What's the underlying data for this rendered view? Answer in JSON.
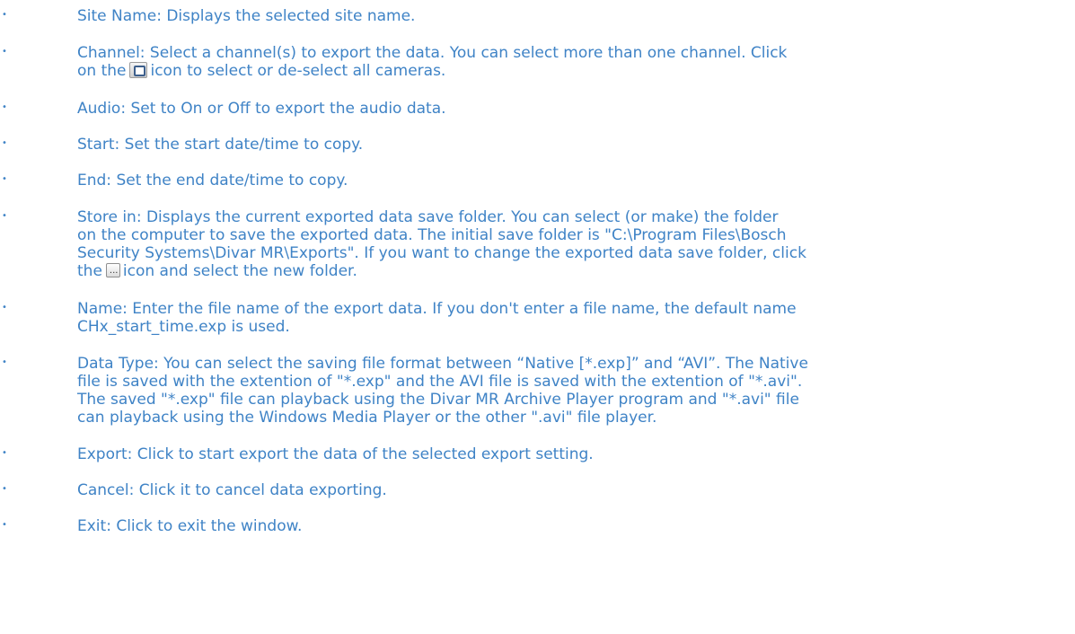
{
  "bullet_glyph": "•",
  "items": [
    {
      "lines": [
        "Site Name: Displays the selected site name."
      ]
    },
    {
      "lines": [
        "Channel: Select a channel(s) to export the data. You can select more than one channel. Click",
        "on the",
        "icon to select or de-select all cameras."
      ],
      "icon": "select-all-icon"
    },
    {
      "lines": [
        "Audio: Set to On or Off to export the audio data."
      ]
    },
    {
      "lines": [
        "Start: Set the start date/time to copy."
      ]
    },
    {
      "lines": [
        "End: Set the end date/time to copy."
      ]
    },
    {
      "lines": [
        "Store in: Displays the current exported data save folder. You can select (or make) the folder",
        "on the computer to save the exported data. The initial save folder is \"C:\\Program Files\\Bosch",
        "Security Systems\\Divar MR\\Exports\". If you want to change the exported data save folder, click",
        "the",
        "icon and select the new folder."
      ],
      "icon": "browse-icon"
    },
    {
      "lines": [
        "Name: Enter the file name of the export data. If you don't enter a file name, the default name",
        "CHx_start_time.exp is used."
      ]
    },
    {
      "lines": [
        "Data Type: You can select the saving file format between “Native [*.exp]” and “AVI”. The Native",
        "file is saved with the extention of \"*.exp\" and the AVI file is saved with the extention of \"*.avi\".",
        "The saved \"*.exp\" file can playback using the Divar MR Archive Player program and \"*.avi\" file",
        "can playback using the Windows Media Player or the other \".avi\" file player."
      ]
    },
    {
      "lines": [
        "Export: Click to start export the data of the selected export setting."
      ]
    },
    {
      "lines": [
        "Cancel: Click it to cancel data exporting."
      ]
    },
    {
      "lines": [
        "Exit: Click to exit the window."
      ]
    }
  ]
}
